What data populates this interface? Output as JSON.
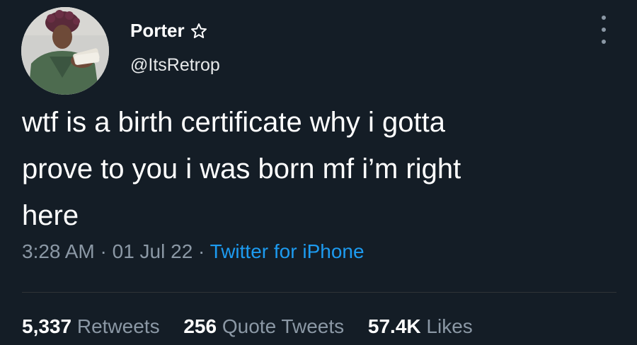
{
  "author": {
    "display_name": "Porter",
    "handle": "@ItsRetrop",
    "badge_icon": "star-outline-icon"
  },
  "tweet": {
    "text": "wtf is a birth certificate why i gotta\nprove to you i was born mf i’m right\nhere"
  },
  "meta": {
    "time": "3:28 AM",
    "separator": "·",
    "date": "01 Jul 22",
    "source": "Twitter for iPhone"
  },
  "stats": {
    "retweets_count": "5,337",
    "retweets_label": "Retweets",
    "quotes_count": "256",
    "quotes_label": "Quote Tweets",
    "likes_count": "57.4K",
    "likes_label": "Likes"
  },
  "colors": {
    "background": "#141d26",
    "text": "#ffffff",
    "secondary": "#8b98a5",
    "accent": "#1d9bf0"
  }
}
